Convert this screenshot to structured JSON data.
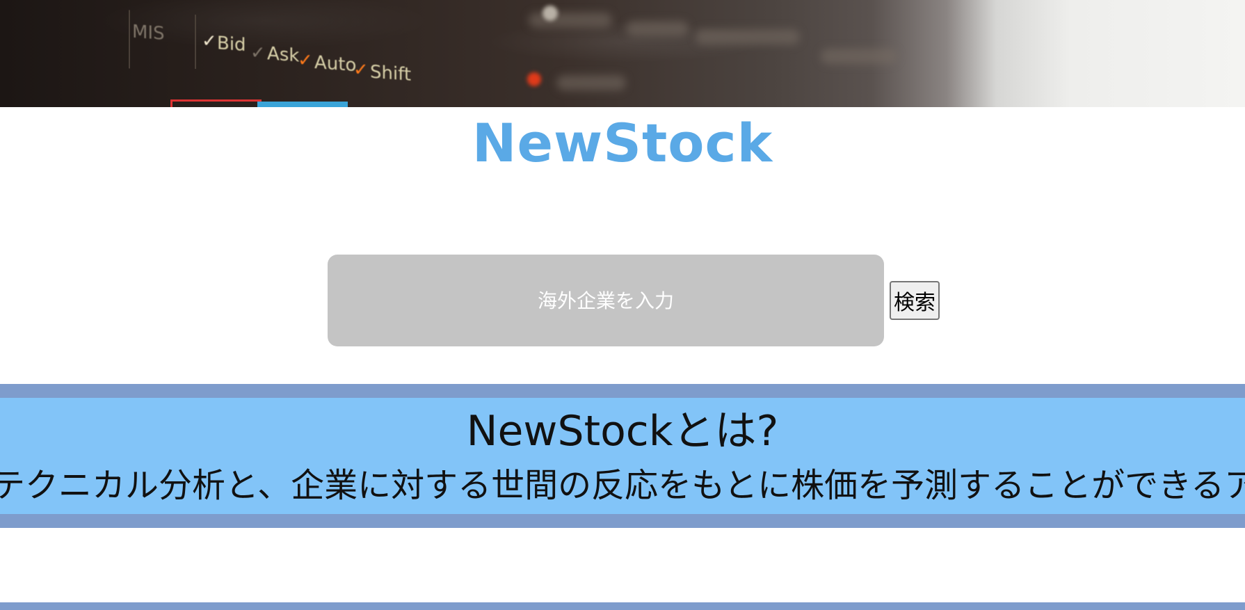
{
  "site": {
    "title": "NewStock"
  },
  "hero": {
    "ticker_labels": [
      "MIS",
      "Bid",
      "Ask",
      "Auto",
      "Shift"
    ]
  },
  "search": {
    "placeholder": "海外企業を入力",
    "button_label": "検索"
  },
  "about": {
    "title": "NewStockとは?",
    "description": "テクニカル分析と、企業に対する世間の反応をもとに株価を予測することができるア"
  },
  "colors": {
    "brand": "#5aa9e6",
    "section_bg": "#82c4f8",
    "section_border": "#7e9ccc",
    "input_bg": "#c4c4c4"
  }
}
